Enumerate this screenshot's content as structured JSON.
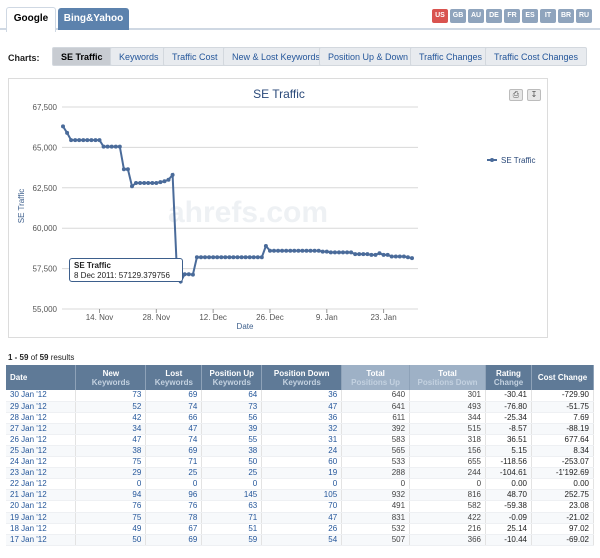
{
  "tabs": {
    "google": "Google",
    "bing": "Bing&Yahoo"
  },
  "langs": [
    "US",
    "GB",
    "AU",
    "DE",
    "FR",
    "ES",
    "IT",
    "BR",
    "RU"
  ],
  "charts": {
    "label": "Charts:",
    "buttons": [
      "SE Traffic",
      "Keywords",
      "Traffic Cost",
      "New & Lost Keywords",
      "Position Up & Down",
      "Traffic Changes",
      "Traffic Cost Changes"
    ]
  },
  "chart_data": {
    "type": "line",
    "title": "SE Traffic",
    "xlabel": "Date",
    "ylabel": "SE Traffic",
    "ylim": [
      55000,
      67500
    ],
    "yticks": [
      "67,500",
      "65,000",
      "62,500",
      "60,000",
      "57,500",
      "55,000"
    ],
    "xticks": [
      "14. Nov",
      "28. Nov",
      "12. Dec",
      "26. Dec",
      "9. Jan",
      "23. Jan"
    ],
    "legend": "SE Traffic",
    "legend_position": "right",
    "watermark": "ahrefs.com",
    "tooltip": {
      "title": "SE Traffic",
      "text": "8 Dec 2011: 57129.379756"
    },
    "series": [
      {
        "name": "SE Traffic",
        "color": "#4a6b9a",
        "x": [
          "5 Nov",
          "6 Nov",
          "7 Nov",
          "8 Nov",
          "9 Nov",
          "10 Nov",
          "11 Nov",
          "12 Nov",
          "13 Nov",
          "14 Nov",
          "15 Nov",
          "16 Nov",
          "17 Nov",
          "18 Nov",
          "19 Nov",
          "20 Nov",
          "21 Nov",
          "22 Nov",
          "23 Nov",
          "24 Nov",
          "25 Nov",
          "26 Nov",
          "27 Nov",
          "28 Nov",
          "29 Nov",
          "30 Nov",
          "1 Dec",
          "2 Dec",
          "3 Dec",
          "4 Dec",
          "5 Dec",
          "6 Dec",
          "7 Dec",
          "8 Dec",
          "9 Dec",
          "10 Dec",
          "11 Dec",
          "12 Dec",
          "13 Dec",
          "14 Dec",
          "15 Dec",
          "16 Dec",
          "17 Dec",
          "18 Dec",
          "19 Dec",
          "20 Dec",
          "21 Dec",
          "22 Dec",
          "23 Dec",
          "24 Dec",
          "25 Dec",
          "26 Dec",
          "27 Dec",
          "28 Dec",
          "29 Dec",
          "30 Dec",
          "31 Dec",
          "1 Jan",
          "2 Jan",
          "3 Jan",
          "4 Jan",
          "5 Jan",
          "6 Jan",
          "7 Jan",
          "8 Jan",
          "9 Jan",
          "10 Jan",
          "11 Jan",
          "12 Jan",
          "13 Jan",
          "14 Jan",
          "15 Jan",
          "16 Jan",
          "17 Jan",
          "18 Jan",
          "19 Jan",
          "20 Jan",
          "21 Jan",
          "22 Jan",
          "23 Jan",
          "24 Jan",
          "25 Jan",
          "26 Jan",
          "27 Jan",
          "28 Jan",
          "29 Jan",
          "30 Jan"
        ],
        "values": [
          66300,
          65900,
          65450,
          65450,
          65450,
          65450,
          65450,
          65450,
          65450,
          65450,
          65050,
          65050,
          65050,
          65050,
          65050,
          63650,
          63650,
          62600,
          62800,
          62800,
          62800,
          62800,
          62800,
          62800,
          62850,
          62900,
          63000,
          63300,
          57800,
          56700,
          57150,
          57150,
          57129,
          58200,
          58200,
          58200,
          58200,
          58200,
          58200,
          58200,
          58200,
          58200,
          58200,
          58200,
          58200,
          58200,
          58200,
          58200,
          58200,
          58200,
          58900,
          58600,
          58600,
          58600,
          58600,
          58600,
          58600,
          58600,
          58600,
          58600,
          58600,
          58600,
          58600,
          58600,
          58550,
          58550,
          58500,
          58500,
          58500,
          58500,
          58500,
          58500,
          58400,
          58400,
          58400,
          58400,
          58350,
          58350,
          58450,
          58350,
          58350,
          58250,
          58250,
          58250,
          58250,
          58200,
          58150
        ]
      }
    ]
  },
  "results": {
    "range": "1 - 59",
    "of_label": "of",
    "total": "59",
    "suffix": "results"
  },
  "table": {
    "headers": [
      {
        "label": "Date",
        "sub": ""
      },
      {
        "label": "New",
        "sub": "Keywords"
      },
      {
        "label": "Lost",
        "sub": "Keywords"
      },
      {
        "label": "Position Up",
        "sub": "Keywords"
      },
      {
        "label": "Position Down",
        "sub": "Keywords"
      },
      {
        "label": "Total",
        "sub": "Positions Up"
      },
      {
        "label": "Total",
        "sub": "Positions Down"
      },
      {
        "label": "Rating",
        "sub": "Change"
      },
      {
        "label": "Cost Change",
        "sub": ""
      }
    ],
    "rows": [
      [
        "30 Jan '12",
        "73",
        "69",
        "64",
        "36",
        "640",
        "301",
        "-30.41",
        "-729.90"
      ],
      [
        "29 Jan '12",
        "52",
        "74",
        "73",
        "47",
        "641",
        "493",
        "-76.80",
        "-51.75"
      ],
      [
        "28 Jan '12",
        "42",
        "66",
        "56",
        "36",
        "611",
        "344",
        "-25.34",
        "7.69"
      ],
      [
        "27 Jan '12",
        "34",
        "47",
        "39",
        "32",
        "392",
        "515",
        "-8.57",
        "-88.19"
      ],
      [
        "26 Jan '12",
        "47",
        "74",
        "55",
        "31",
        "583",
        "318",
        "36.51",
        "677.64"
      ],
      [
        "25 Jan '12",
        "38",
        "69",
        "38",
        "24",
        "565",
        "156",
        "5.15",
        "8.34"
      ],
      [
        "24 Jan '12",
        "75",
        "71",
        "50",
        "60",
        "533",
        "655",
        "-118.56",
        "-253.07"
      ],
      [
        "23 Jan '12",
        "29",
        "25",
        "25",
        "19",
        "288",
        "244",
        "-104.61",
        "-1'192.69"
      ],
      [
        "22 Jan '12",
        "0",
        "0",
        "0",
        "0",
        "0",
        "0",
        "0.00",
        "0.00"
      ],
      [
        "21 Jan '12",
        "94",
        "96",
        "145",
        "105",
        "932",
        "816",
        "48.70",
        "252.75"
      ],
      [
        "20 Jan '12",
        "76",
        "76",
        "63",
        "70",
        "491",
        "582",
        "-59.38",
        "23.08"
      ],
      [
        "19 Jan '12",
        "75",
        "78",
        "71",
        "47",
        "831",
        "422",
        "-0.09",
        "-21.02"
      ],
      [
        "18 Jan '12",
        "49",
        "67",
        "51",
        "26",
        "532",
        "216",
        "25.14",
        "97.02"
      ],
      [
        "17 Jan '12",
        "50",
        "69",
        "59",
        "54",
        "507",
        "366",
        "-10.44",
        "-69.02"
      ]
    ]
  }
}
